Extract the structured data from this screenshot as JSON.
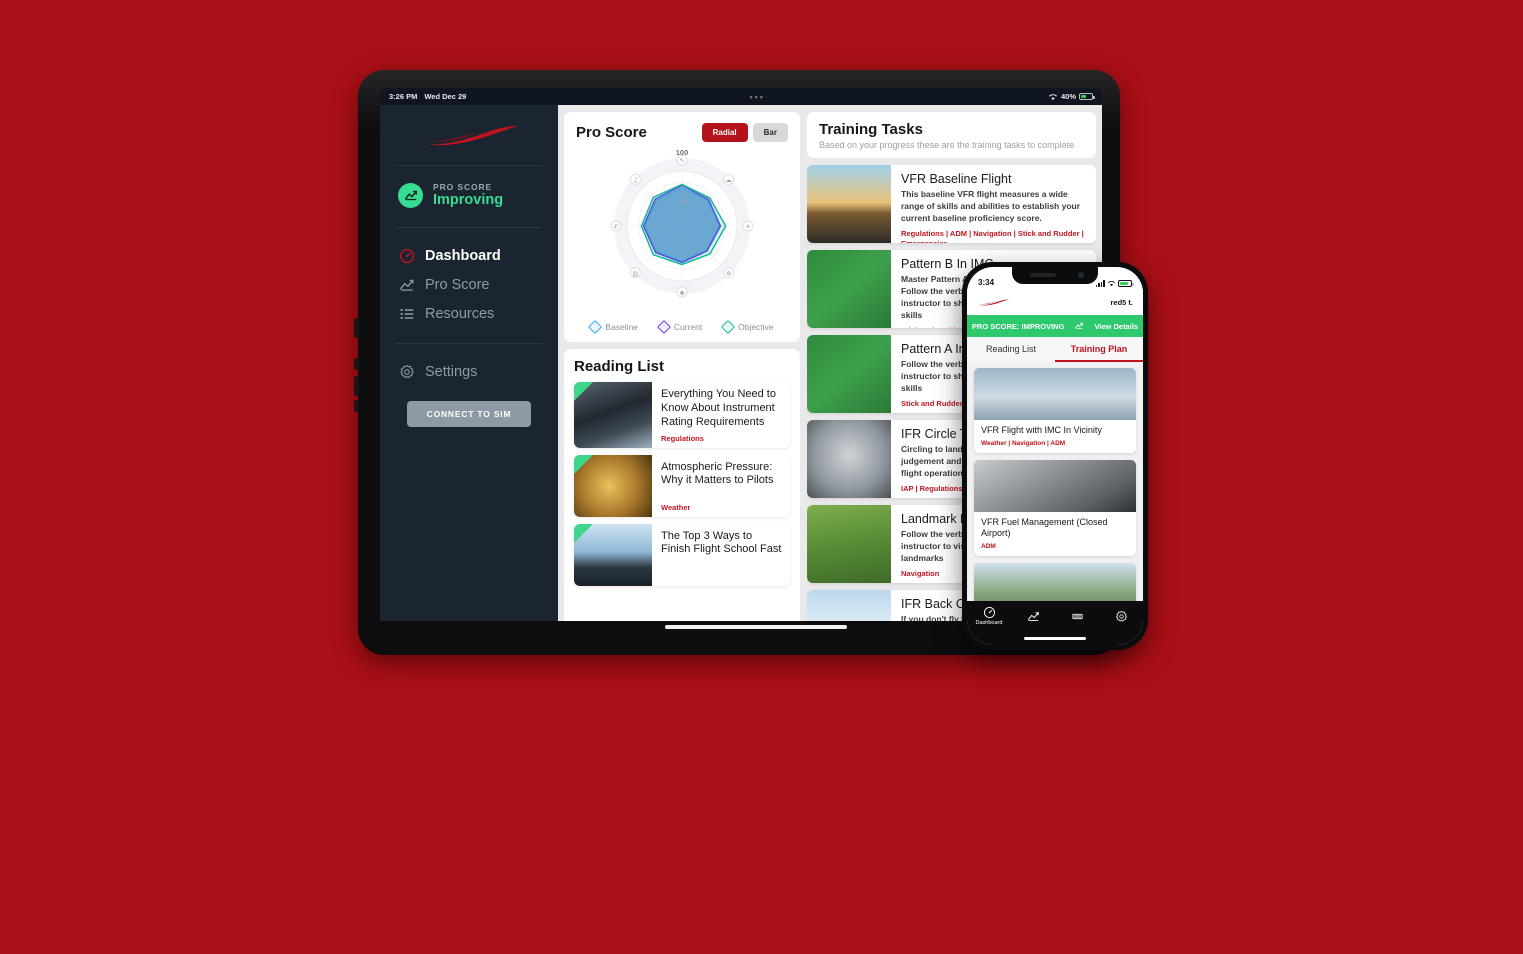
{
  "background_color": "#ab0f16",
  "tablet": {
    "status_bar": {
      "time": "3:26 PM",
      "date": "Wed Dec 29",
      "center_dots": "•••",
      "battery_pct": "40%"
    },
    "sidebar": {
      "logo_name": "red5-swoosh-logo",
      "pro_score": {
        "label": "PRO SCORE",
        "value": "Improving",
        "icon": "chart-trend-up-icon"
      },
      "items": [
        {
          "label": "Dashboard",
          "icon": "gauge-icon",
          "active": true
        },
        {
          "label": "Pro Score",
          "icon": "chart-line-icon",
          "active": false
        },
        {
          "label": "Resources",
          "icon": "list-icon",
          "active": false
        }
      ],
      "settings": {
        "label": "Settings",
        "icon": "gear-icon"
      },
      "connect_button": "CONNECT TO SIM"
    },
    "pro_score_card": {
      "title": "Pro Score",
      "toggle": {
        "options": [
          "Radial",
          "Bar"
        ],
        "selected": "Radial"
      },
      "legend": [
        {
          "label": "Baseline",
          "color": "#3aa8e8"
        },
        {
          "label": "Current",
          "color": "#6a3de8"
        },
        {
          "label": "Objective",
          "color": "#16b89a"
        }
      ]
    },
    "reading_list": {
      "title": "Reading List",
      "items": [
        {
          "title": "Everything You Need to Know About Instrument Rating Requirements",
          "tags": "Regulations",
          "completed": true,
          "thumb": "cockpit-panel-photo"
        },
        {
          "title": "Atmospheric Pressure: Why it Matters to Pilots",
          "tags": "Weather",
          "completed": true,
          "thumb": "barometer-photo"
        },
        {
          "title": "The Top 3 Ways to Finish Flight School Fast",
          "tags": "",
          "completed": true,
          "thumb": "cockpit-window-photo"
        }
      ]
    },
    "training_tasks": {
      "title": "Training Tasks",
      "subtitle": "Based on your progress these are the training tasks to complete",
      "items": [
        {
          "title": "VFR Baseline Flight",
          "desc": "This baseline VFR flight measures a wide range of skills and abilities to establish your current baseline proficiency score.",
          "tags": "Regulations | ADM | Navigation | Stick and Rudder | Emergencies",
          "thumb": "runway-sunset-photo"
        },
        {
          "title": "Pattern B In IMC",
          "desc": "Master Pattern A before attempting Pattern B. Follow the verbal instructions of your instructor to sharpen your IMC maneuvers skills",
          "tags": "Stick and Rudder",
          "thumb": "pattern-diagram-green"
        },
        {
          "title": "Pattern A In IMC",
          "desc": "Follow the verbal instructions of your instructor to sharpen your IMC maneuvers skills",
          "tags": "Stick and Rudder",
          "thumb": "pattern-diagram-green"
        },
        {
          "title": "IFR Circle To Land",
          "desc": "Circling to land requires skill, sound judgement and dedication to safe and legal flight operations.",
          "tags": "IAP | Regulations | ADM",
          "thumb": "attitude-indicator-photo"
        },
        {
          "title": "Landmark Navigation",
          "desc": "Follow the verbal instructions of your instructor to visually navigate around landmarks",
          "tags": "Navigation",
          "thumb": "winding-road-photo"
        },
        {
          "title": "IFR Back Course",
          "desc": "If you don't fly back courses often, the procedure may feel unfamiliar the first time",
          "tags": "",
          "thumb": "sky-clouds-photo"
        }
      ]
    }
  },
  "phone": {
    "status_bar": {
      "time": "3:34",
      "location_icon": "location-arrow-icon"
    },
    "header": {
      "logo_name": "red5-swoosh-logo",
      "user": "red5 t."
    },
    "banner": {
      "text": "PRO SCORE: IMPROVING",
      "icon": "chart-trend-up-icon",
      "action": "View Details"
    },
    "tabs": [
      {
        "label": "Reading List",
        "active": false
      },
      {
        "label": "Training Plan",
        "active": true
      }
    ],
    "cards": [
      {
        "title": "VFR Flight with IMC In Vicinity",
        "tags": "Weather | Navigation | ADM",
        "thumb": "airplane-in-clouds-photo"
      },
      {
        "title": "VFR Fuel Management (Closed Airport)",
        "tags": "ADM",
        "thumb": "instrument-panel-photo"
      },
      {
        "title": "",
        "tags": "",
        "thumb": "mountain-landscape-photo"
      }
    ],
    "bottom_nav": [
      {
        "label": "Dashboard",
        "icon": "gauge-icon",
        "active": true
      },
      {
        "label": "",
        "icon": "chart-line-icon",
        "active": false
      },
      {
        "label": "",
        "icon": "list-icon",
        "active": false
      },
      {
        "label": "",
        "icon": "gear-icon",
        "active": false
      }
    ]
  },
  "chart_data": {
    "type": "radar",
    "title": "Pro Score",
    "axis_ticks": [
      "20",
      "100"
    ],
    "rmin": 0,
    "rmax": 100,
    "categories": [
      "Regulations",
      "Weather",
      "Navigation",
      "Stick and Rudder",
      "Emergencies",
      "IAP",
      "ADM",
      "Comms"
    ],
    "category_icons": [
      "pencil-icon",
      "cloud-icon",
      "airplane-icon",
      "car-icon",
      "radio-icon",
      "battery-icon",
      "phone-icon",
      "headphones-icon"
    ],
    "series": [
      {
        "name": "Baseline",
        "color": "#3aa8e8",
        "values": [
          74,
          70,
          72,
          66,
          68,
          70,
          72,
          70
        ]
      },
      {
        "name": "Current",
        "color": "#6a3de8",
        "values": [
          78,
          72,
          74,
          68,
          70,
          72,
          74,
          73
        ]
      },
      {
        "name": "Objective",
        "color": "#16b89a",
        "values": [
          80,
          76,
          84,
          76,
          74,
          78,
          78,
          78
        ]
      }
    ],
    "legend_position": "bottom",
    "grid": true
  }
}
